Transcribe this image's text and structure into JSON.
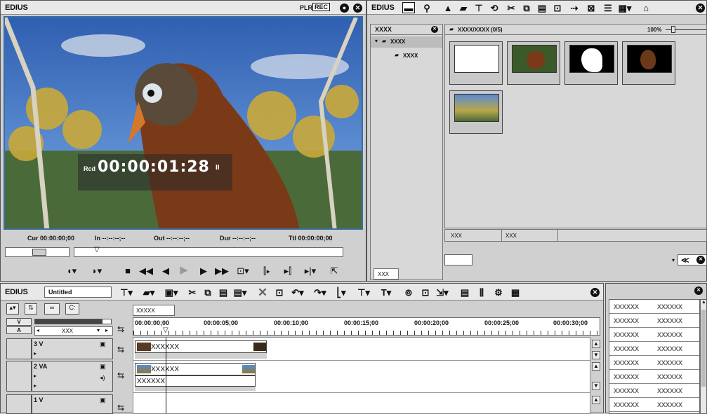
{
  "player": {
    "app": "EDIUS",
    "mode_plr": "PLR",
    "mode_rec": "REC",
    "rcd_label": "Rcd",
    "timecode": "00:00:01:28",
    "pause_glyph": "II",
    "cur": "Cur 00:00:00;00",
    "in": "In --:--:--;--",
    "out": "Out --:--:--;--",
    "dur": "Dur --:--:--;--",
    "ttl": "Ttl 00:00:00;00"
  },
  "bin": {
    "app": "EDIUS",
    "tree_title": "XXXX",
    "tree_root": "XXXX",
    "tree_child": "XXXX",
    "path": "XXXX/XXXX (0/5)",
    "zoom": "100%",
    "col1": "XXX",
    "col2": "XXX",
    "tab": "XXX",
    "nav_glyph": "≪"
  },
  "timeline": {
    "app": "EDIUS",
    "project": "Untitled",
    "seq_tab": "XXXXX",
    "v_label": "V",
    "a_label": "A",
    "channel": "XXX",
    "ruler": [
      "00:00:00;00",
      "00:00:05;00",
      "00:00:10;00",
      "00:00:15;00",
      "00:00:20;00",
      "00:00:25;00",
      "00:00:30;00"
    ],
    "tracks": [
      {
        "name": "3 V",
        "clip": "XXXXXX"
      },
      {
        "name": "2 VA",
        "clip": "XXXXXX",
        "audio": "XXXXXX"
      },
      {
        "name": "1 V"
      }
    ]
  },
  "info_table": {
    "rows": [
      [
        "XXXXXX",
        "XXXXXX"
      ],
      [
        "XXXXXX",
        "XXXXXX"
      ],
      [
        "XXXXXX",
        "XXXXXX"
      ],
      [
        "XXXXXX",
        "XXXXXX"
      ],
      [
        "XXXXXX",
        "XXXXXX"
      ],
      [
        "XXXXXX",
        "XXXXXX"
      ],
      [
        "XXXXXX",
        "XXXXXX"
      ],
      [
        "XXXXXX",
        "XXXXXX"
      ]
    ]
  },
  "colors": {
    "accent": "#3a6ea5",
    "bg": "#d0d0d0"
  }
}
